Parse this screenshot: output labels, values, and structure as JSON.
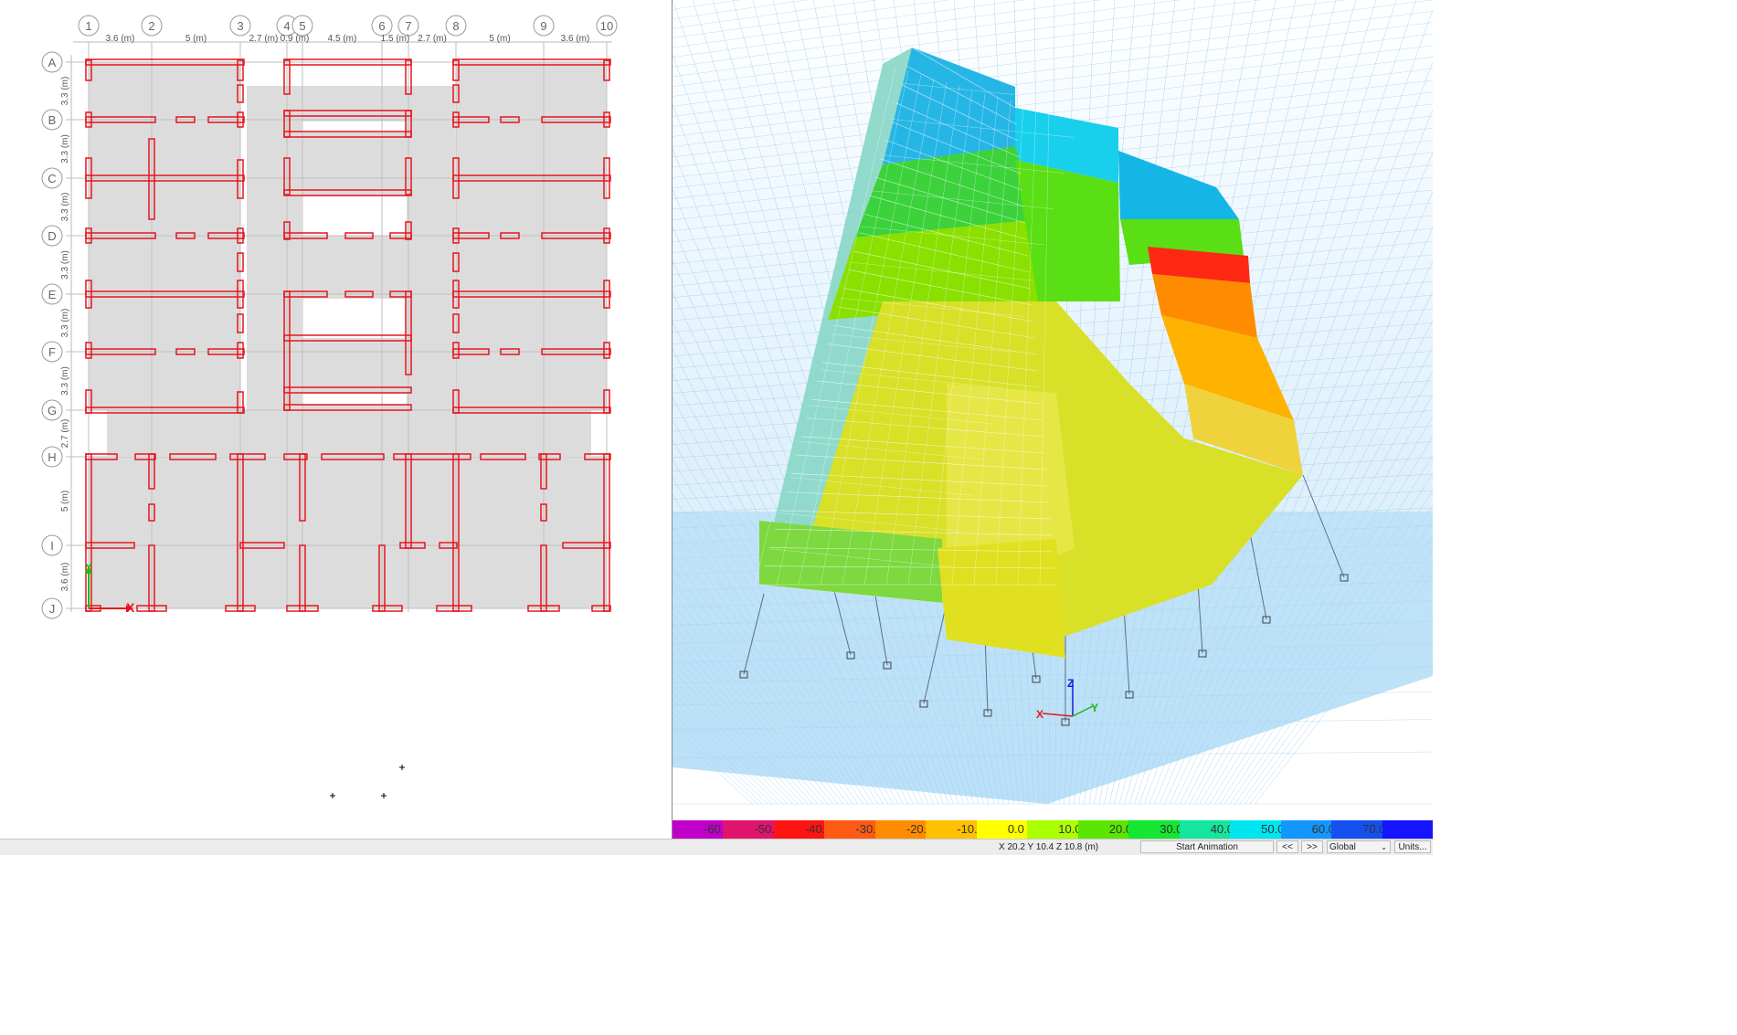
{
  "plan": {
    "grid_x_labels": [
      "1",
      "2",
      "3",
      "4",
      "5",
      "6",
      "7",
      "8",
      "9",
      "10"
    ],
    "grid_y_labels": [
      "A",
      "B",
      "C",
      "D",
      "E",
      "F",
      "G",
      "H",
      "I",
      "J"
    ],
    "x_spacing_labels": [
      "3.6 (m)",
      "5 (m)",
      "2.7 (m)",
      "0.9 (m)",
      "4.5 (m)",
      "1.5 (m)",
      "2.7 (m)",
      "5 (m)",
      "3.6 (m)"
    ],
    "y_spacing_labels": [
      "3.3 (m)",
      "3.3 (m)",
      "3.3 (m)",
      "3.3 (m)",
      "3.3 (m)",
      "3.3 (m)",
      "2.7 (m)",
      "5 (m)",
      "3.6 (m)"
    ],
    "axis_x_label": "X",
    "axis_y_label": "Y",
    "colors": {
      "wall": "#e8141e",
      "slab": "#dcdcdc",
      "bubble": "#9a9a9a",
      "gridline": "#bfbfbf"
    }
  },
  "model3d": {
    "axis_labels": {
      "x": "X",
      "y": "Y",
      "z": "Z"
    },
    "colors": {
      "mesh_bg": "#a9d8f5",
      "mesh_line": "#6bb6ec",
      "frame_line": "#5a6f8a"
    }
  },
  "legend": {
    "stops": [
      {
        "label": "-60.0",
        "color": "#c000c8"
      },
      {
        "label": "-50.0",
        "color": "#e0146e"
      },
      {
        "label": "-40.0",
        "color": "#ff1414"
      },
      {
        "label": "-30.0",
        "color": "#ff5a14"
      },
      {
        "label": "-20.0",
        "color": "#ff8c00"
      },
      {
        "label": "-10.0",
        "color": "#ffc000"
      },
      {
        "label": "0.0",
        "color": "#ffff00"
      },
      {
        "label": "10.0",
        "color": "#aaff00"
      },
      {
        "label": "20.0",
        "color": "#5ae600"
      },
      {
        "label": "30.0",
        "color": "#14e632"
      },
      {
        "label": "40.0",
        "color": "#14e6a0"
      },
      {
        "label": "50.0",
        "color": "#00e6f0"
      },
      {
        "label": "60.0",
        "color": "#1496ff"
      },
      {
        "label": "70.0",
        "color": "#1450f0"
      },
      {
        "label": "",
        "color": "#1414ff"
      }
    ]
  },
  "status": {
    "coords": "X 20.2  Y 10.4  Z 10.8 (m)",
    "start_animation": "Start Animation",
    "prev": "<<",
    "next": ">>",
    "coord_system": "Global",
    "units": "Units..."
  }
}
